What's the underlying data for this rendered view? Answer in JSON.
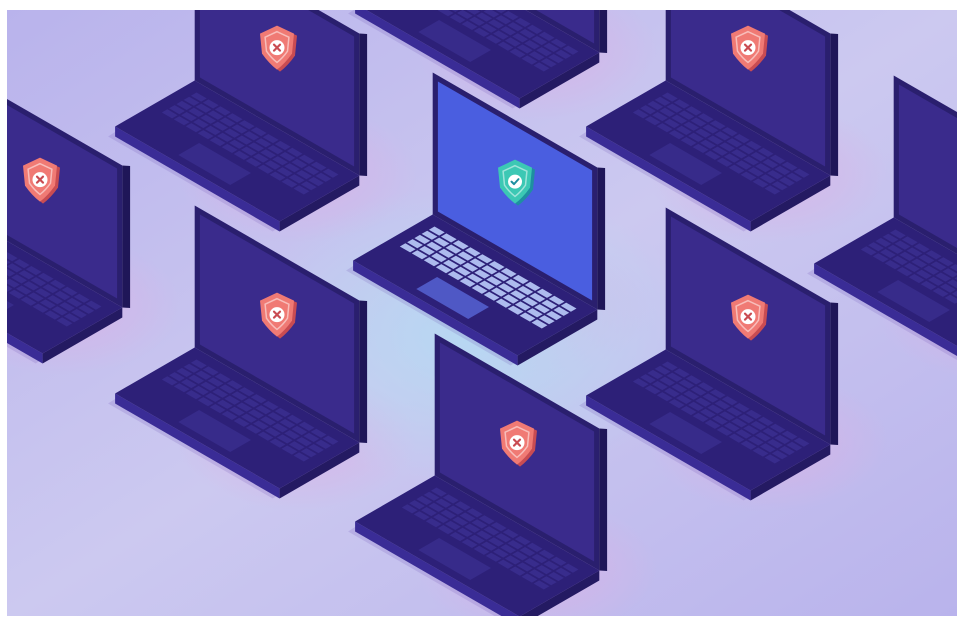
{
  "image": {
    "subject": "",
    "colors": {
      "frame": "#ffffff",
      "background_light": "#ccc9f0",
      "background_pink": "#d9b2e6",
      "background_violet": "#b9b3ec",
      "center_glow": "#b6d8f2",
      "laptop_body": "#2d2078",
      "laptop_body_edge": "#3a2c96",
      "laptop_screen": "#3a2b8c",
      "laptop_screen_frame": "#2a1f6e",
      "key_dark": "#3a2e8e",
      "secure_screen": "#4a5ee0",
      "secure_keys": "#b4c4f4",
      "shield_warning": "#f07a74",
      "shield_warning_dark": "#c94c52",
      "shield_secure": "#3cc8b4",
      "shield_secure_dark": "#1e8fa0"
    },
    "laptops": [
      {
        "status": "compromised",
        "shield_icon": "shield-x-icon"
      },
      {
        "status": "compromised",
        "shield_icon": "shield-x-icon"
      },
      {
        "status": "compromised",
        "shield_icon": "shield-x-icon"
      },
      {
        "status": "compromised",
        "shield_icon": "shield-x-icon"
      },
      {
        "status": "secure",
        "shield_icon": "shield-check-icon"
      },
      {
        "status": "compromised",
        "shield_icon": "shield-x-icon"
      },
      {
        "status": "compromised",
        "shield_icon": "shield-x-icon"
      },
      {
        "status": "compromised",
        "shield_icon": "shield-x-icon"
      },
      {
        "status": "compromised",
        "shield_icon": "shield-x-icon"
      }
    ]
  }
}
